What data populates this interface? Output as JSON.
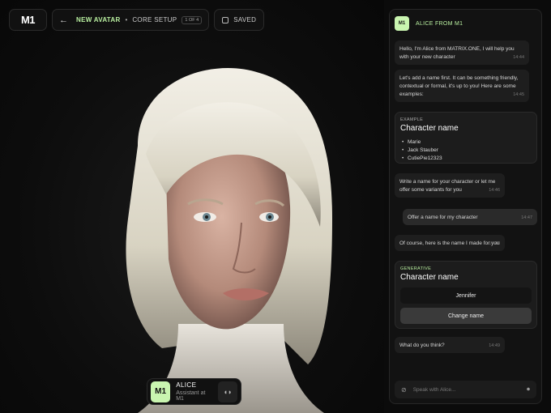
{
  "brand": {
    "logo": "M1"
  },
  "topbar": {
    "back_icon": "arrow-left-icon",
    "step": "NEW AVATAR",
    "separator": "•",
    "section": "CORE SETUP",
    "badge": "1 OF 4",
    "saved_label": "SAVED"
  },
  "assistant": {
    "avatar": "M1",
    "name": "ALICE",
    "role": "Assistant at M1"
  },
  "chat": {
    "header_avatar": "M1",
    "title": "ALICE FROM M1",
    "messages": [
      {
        "text": "Hello, I'm Alice from MATRIX.ONE, I will help you with your new character",
        "time": "14:44"
      },
      {
        "text": "Let's add a name first. It can be something friendly, contextual or formal, it's up to you! Here are some examples:",
        "time": "14:45"
      },
      {
        "text": "Write a name for your character or let me offer some variants for you",
        "time": "14:46"
      },
      {
        "text": "Offer a name for my character",
        "time": "14:47"
      },
      {
        "text": "Of course, here is the name I made for you",
        "time": "14:48"
      },
      {
        "text": "What do you think?",
        "time": "14:49"
      }
    ],
    "example_card": {
      "kicker": "EXAMPLE",
      "title": "Character name",
      "items": [
        "Marie",
        "Jack Stauber",
        "CutiePie12323"
      ]
    },
    "generative_card": {
      "kicker": "GENERATIVE",
      "title": "Character name",
      "name": "Jennifer",
      "button": "Change name"
    },
    "input_placeholder": "Speak with Alice..."
  },
  "colors": {
    "accent": "#b9f0a0",
    "avatar_bg": "#c9f5b0"
  }
}
